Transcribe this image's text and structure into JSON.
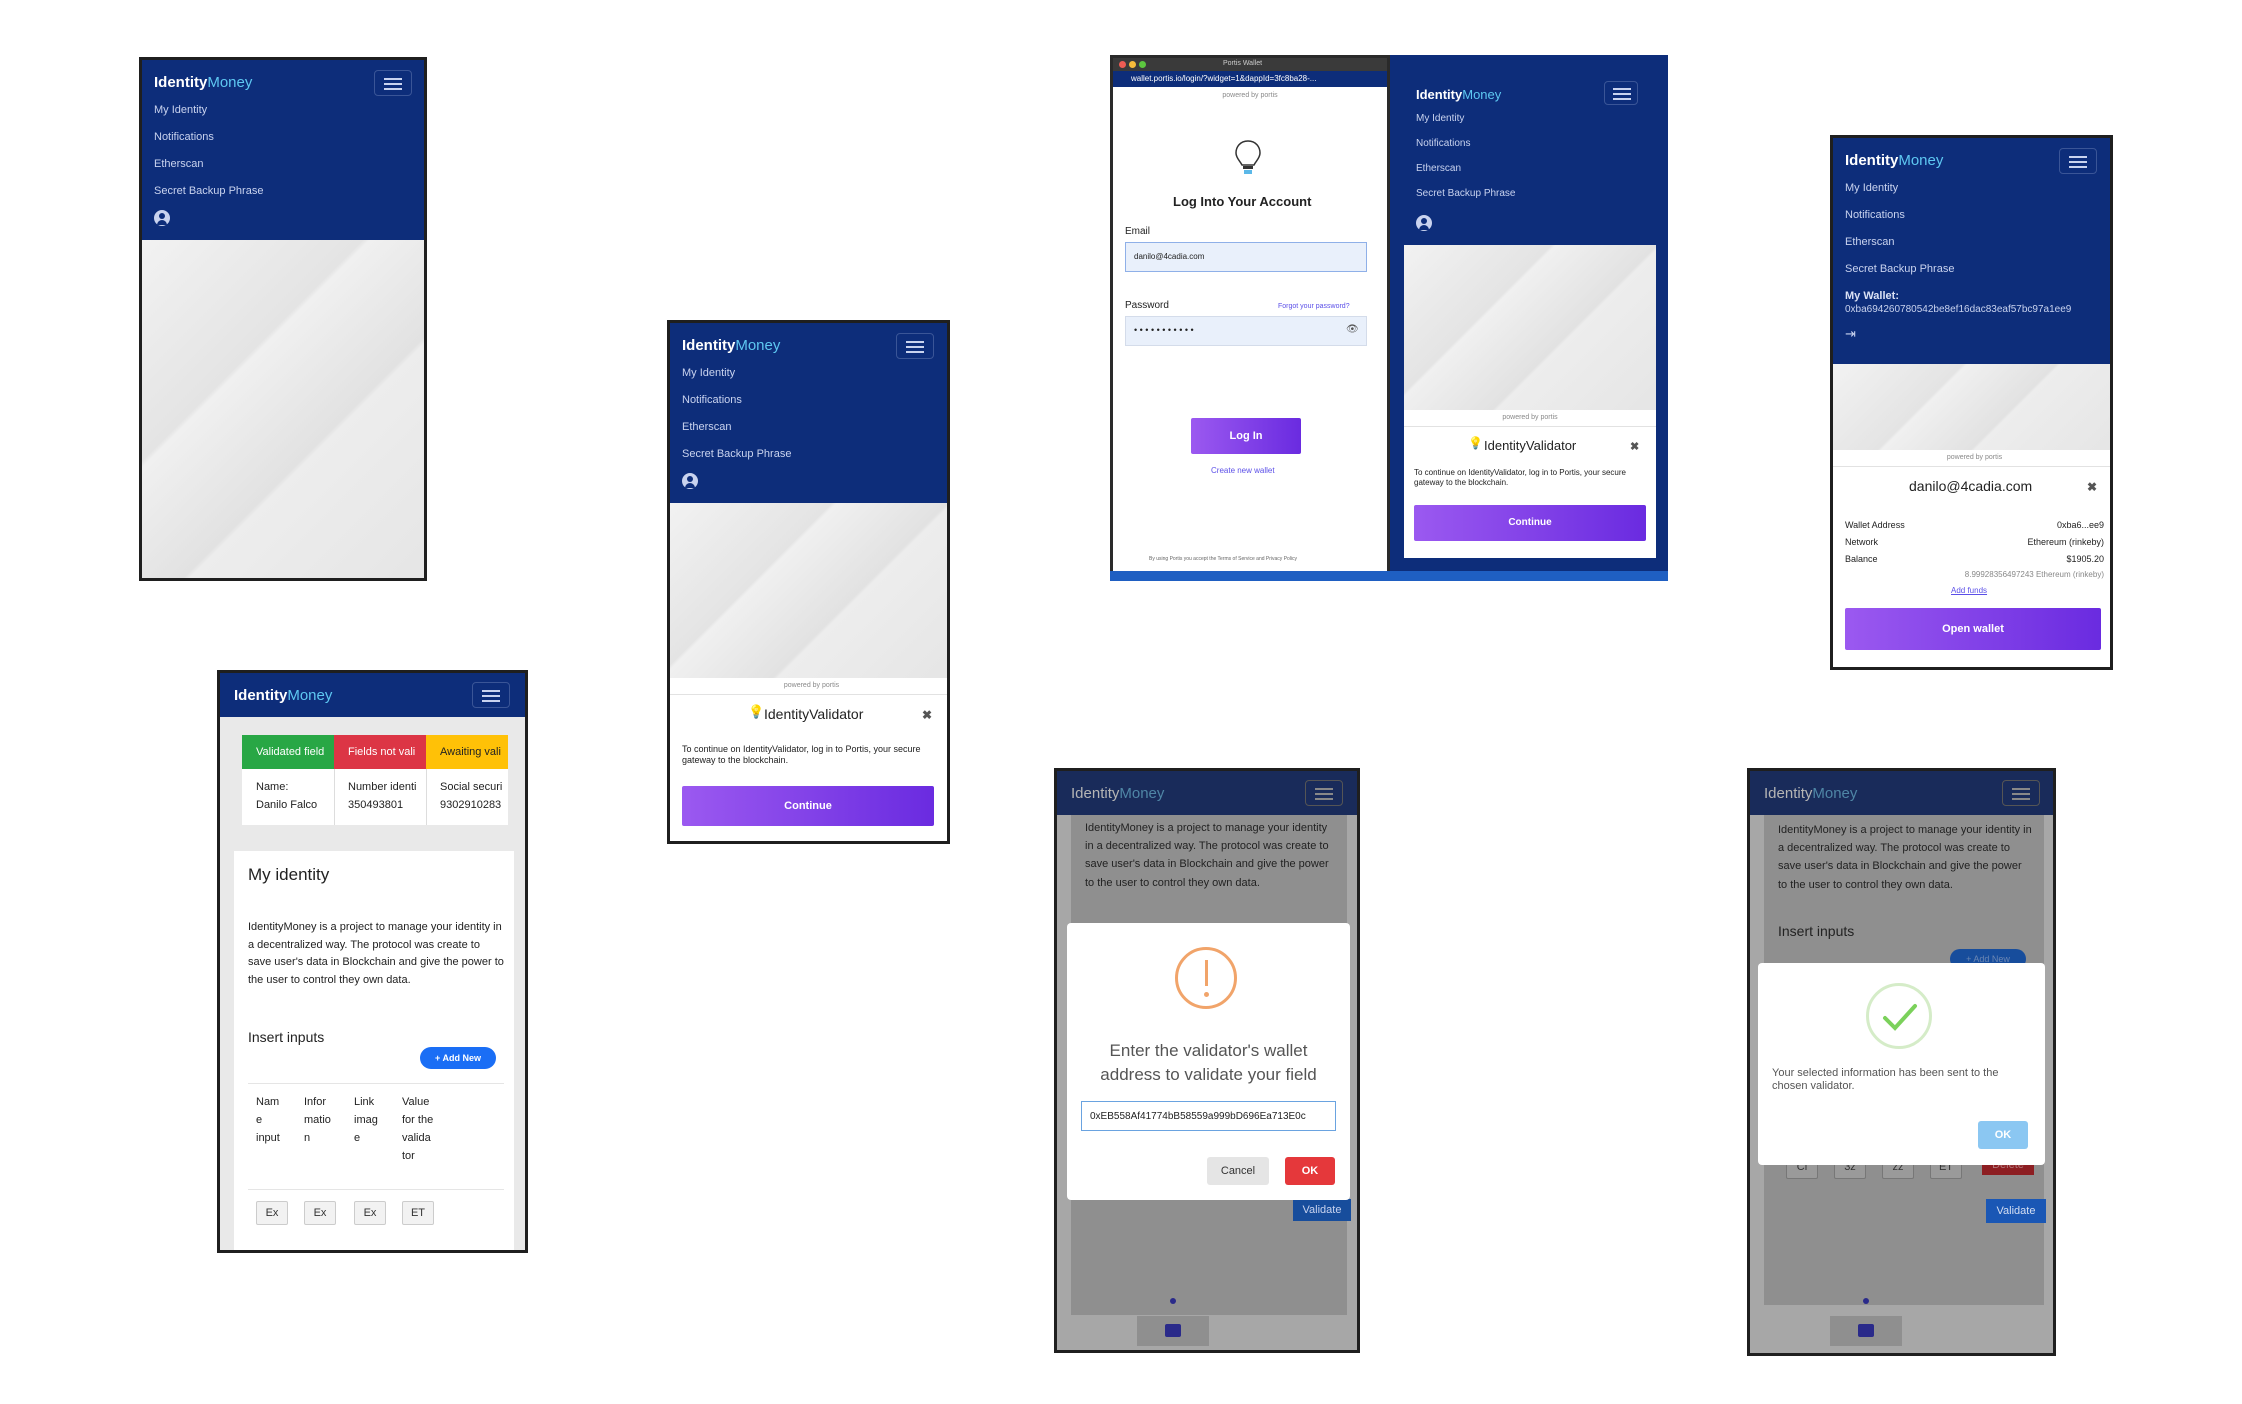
{
  "brand": {
    "identity": "Identity",
    "money": "Money"
  },
  "nav": [
    "My Identity",
    "Notifications",
    "Etherscan",
    "Secret Backup Phrase"
  ],
  "portis": {
    "powered_by": "powered by",
    "brand": "portis",
    "validator_title": "IdentityValidator",
    "continue_text": "To continue on IdentityValidator, log in to Portis, your secure gateway to the blockchain.",
    "continue_button": "Continue"
  },
  "login": {
    "window_title": "Portis Wallet",
    "url": "wallet.portis.io/login/?widget=1&dappId=3fc8ba28-...",
    "heading": "Log Into Your Account",
    "email_label": "Email",
    "email_value": "danilo@4cadia.com",
    "password_label": "Password",
    "forgot": "Forgot your password?",
    "password_mask": "• • • • • • • • • • •",
    "login_button": "Log In",
    "create_wallet": "Create new wallet",
    "terms": "By using Portis you accept the Terms of Service and Privacy Policy"
  },
  "wallet_screen": {
    "my_wallet_label": "My Wallet:",
    "wallet_address_full": "0xba694260780542be8ef16dac83eaf57bc97a1ee9",
    "email": "danilo@4cadia.com",
    "rows": [
      {
        "label": "Wallet Address",
        "value": "0xba6...ee9"
      },
      {
        "label": "Network",
        "value": "Ethereum (rinkeby)"
      },
      {
        "label": "Balance",
        "value": "$1905.20"
      }
    ],
    "eth_balance": "8.99928356497243 Ethereum (rinkeby)",
    "add_funds": "Add funds",
    "open_wallet": "Open wallet"
  },
  "identity_screen": {
    "status_cols": [
      "Validated field",
      "Fields not vali",
      "Awaiting vali"
    ],
    "status_colors": [
      "#28a745",
      "#dc3545",
      "#ffc107"
    ],
    "cells": [
      {
        "label": "Name:",
        "value": "Danilo Falco"
      },
      {
        "label": "Number identi",
        "value": "350493801"
      },
      {
        "label": "Social securi",
        "value": "9302910283"
      }
    ],
    "title": "My identity",
    "description": "IdentityMoney is a project to manage your identity in a decentralized way. The protocol was create to save user's data in Blockchain and give the power to the user to control they own data.",
    "insert_inputs": "Insert inputs",
    "add_new": "+ Add New",
    "table_headers": [
      "Nam e input",
      "Infor matio n",
      "Link imag e",
      "Value for the valida tor"
    ],
    "row_chips": [
      "Ex",
      "Ex",
      "Ex",
      "ET"
    ]
  },
  "validator_modal": {
    "bg_text": "IdentityMoney is a project to manage your identity in a decentralized way. The protocol was create to save user's data in Blockchain and give the power to the user to control they own data.",
    "message": "Enter the validator's wallet address to validate your field",
    "address_value": "0xEB558Af41774bB58559a999bD696Ea713E0c",
    "cancel": "Cancel",
    "ok": "OK",
    "validate": "Validate"
  },
  "success_modal": {
    "bg_text": "IdentityMoney is a project to manage your identity in a decentralized way. The protocol was create to save user's data in Blockchain and give the power to the user to control they own data.",
    "insert_inputs": "Insert inputs",
    "message": "Your selected information has been sent to the chosen validator.",
    "ok": "OK",
    "chips": [
      "Cl",
      "3z",
      "zz",
      "ET"
    ],
    "delete": "Delete",
    "validate": "Validate",
    "add_new": "+ Add New"
  }
}
